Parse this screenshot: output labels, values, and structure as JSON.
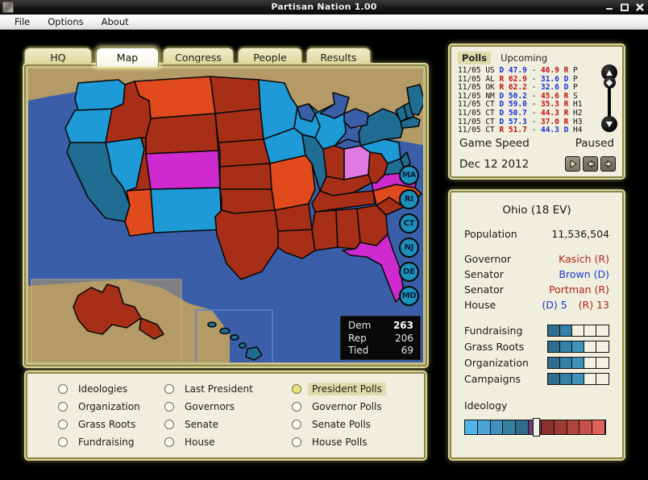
{
  "window": {
    "title": "Partisan Nation  1.00",
    "icon": "app-icon",
    "buttons": {
      "minimize": "minimize-icon",
      "maximize": "maximize-icon",
      "close": "close-icon"
    }
  },
  "menubar": {
    "items": [
      "File",
      "Options",
      "About"
    ]
  },
  "tabs": [
    {
      "label": "HQ",
      "active": false
    },
    {
      "label": "Map",
      "active": true
    },
    {
      "label": "Congress",
      "active": false
    },
    {
      "label": "People",
      "active": false
    },
    {
      "label": "Results",
      "active": false
    }
  ],
  "map": {
    "ev_box": {
      "rows": [
        {
          "label": "Dem",
          "value": "263"
        },
        {
          "label": "Rep",
          "value": "206"
        },
        {
          "label": "Tied",
          "value": "69"
        }
      ]
    },
    "state_circles": [
      "MA",
      "RI",
      "CT",
      "NJ",
      "DE",
      "MD"
    ],
    "ocean_color": "#3a5fa8",
    "land_color": "#b49a66",
    "colors": {
      "dem_strong": "#1f6d92",
      "dem": "#1e9ad6",
      "tied": "#cf2ad0",
      "tied_light": "#e07ae3",
      "rep": "#e04a1c",
      "rep_strong": "#a82f17"
    },
    "state_fills": {
      "WA": "dem",
      "OR": "dem",
      "CA": "dem_strong",
      "NV": "dem",
      "ID": "rep_strong",
      "MT": "rep",
      "WY": "rep_strong",
      "UT": "rep_strong",
      "CO": "tied",
      "AZ": "rep",
      "NM": "dem",
      "ND": "rep_strong",
      "SD": "rep_strong",
      "NE": "rep_strong",
      "KS": "rep_strong",
      "OK": "rep_strong",
      "TX": "rep_strong",
      "MN": "dem",
      "IA": "dem",
      "MO": "rep",
      "AR": "rep_strong",
      "LA": "rep_strong",
      "WI": "dem",
      "IL": "dem",
      "MI": "dem",
      "IN": "rep_strong",
      "OH": "tied_light",
      "KY": "rep_strong",
      "TN": "rep_strong",
      "MS": "rep_strong",
      "AL": "rep_strong",
      "GA": "rep_strong",
      "FL": "tied",
      "SC": "rep_strong",
      "NC": "rep",
      "VA": "tied",
      "WV": "rep_strong",
      "PA": "dem",
      "NY": "dem_strong",
      "ME": "dem_strong",
      "NH": "dem_strong",
      "VT": "dem_strong",
      "MA": "dem_strong",
      "AK": "rep_strong",
      "HI": "dem_strong"
    }
  },
  "options": {
    "columns": [
      [
        {
          "label": "Ideologies",
          "selected": false
        },
        {
          "label": "Organization",
          "selected": false
        },
        {
          "label": "Grass Roots",
          "selected": false
        },
        {
          "label": "Fundraising",
          "selected": false
        }
      ],
      [
        {
          "label": "Last President",
          "selected": false
        },
        {
          "label": "Governors",
          "selected": false
        },
        {
          "label": "Senate",
          "selected": false
        },
        {
          "label": "House",
          "selected": false
        }
      ],
      [
        {
          "label": "President Polls",
          "selected": true
        },
        {
          "label": "Governor Polls",
          "selected": false
        },
        {
          "label": "Senate Polls",
          "selected": false
        },
        {
          "label": "House Polls",
          "selected": false
        }
      ]
    ]
  },
  "polls": {
    "tabs": [
      {
        "label": "Polls",
        "active": true
      },
      {
        "label": "Upcoming",
        "active": false
      }
    ],
    "rows": [
      {
        "date": "11/05",
        "state": "US",
        "lead_party": "D",
        "lead_pct": "47.9",
        "trail_pct": "46.9",
        "trail_party": "R",
        "race": "P"
      },
      {
        "date": "11/05",
        "state": "AL",
        "lead_party": "R",
        "lead_pct": "62.9",
        "trail_pct": "31.6",
        "trail_party": "D",
        "race": "P"
      },
      {
        "date": "11/05",
        "state": "OK",
        "lead_party": "R",
        "lead_pct": "62.2",
        "trail_pct": "32.6",
        "trail_party": "D",
        "race": "P"
      },
      {
        "date": "11/05",
        "state": "NM",
        "lead_party": "D",
        "lead_pct": "50.2",
        "trail_pct": "45.6",
        "trail_party": "R",
        "race": "S"
      },
      {
        "date": "11/05",
        "state": "CT",
        "lead_party": "D",
        "lead_pct": "59.0",
        "trail_pct": "35.3",
        "trail_party": "R",
        "race": "H1"
      },
      {
        "date": "11/05",
        "state": "CT",
        "lead_party": "D",
        "lead_pct": "50.7",
        "trail_pct": "44.3",
        "trail_party": "R",
        "race": "H2"
      },
      {
        "date": "11/05",
        "state": "CT",
        "lead_party": "D",
        "lead_pct": "57.3",
        "trail_pct": "37.0",
        "trail_party": "R",
        "race": "H3"
      },
      {
        "date": "11/05",
        "state": "CT",
        "lead_party": "R",
        "lead_pct": "51.7",
        "trail_pct": "44.3",
        "trail_party": "D",
        "race": "H4"
      }
    ],
    "speed_label": "Game Speed",
    "speed_value": "Paused",
    "date": "Dec 12 2012",
    "buttons": [
      "play-icon",
      "speed-down-icon",
      "speed-up-icon"
    ],
    "scrollbar": {
      "up": "scroll-up-icon",
      "down": "scroll-down-icon",
      "thumb": "scroll-thumb"
    }
  },
  "state_info": {
    "title": "Ohio (18 EV)",
    "population_label": "Population",
    "population_value": "11,536,504",
    "rows": [
      {
        "label": "Governor",
        "value": "Kasich (R)",
        "party": "rep"
      },
      {
        "label": "Senator",
        "value": "Brown (D)",
        "party": "dem"
      },
      {
        "label": "Senator",
        "value": "Portman (R)",
        "party": "rep"
      }
    ],
    "house_label": "House",
    "house_dem": "(D) 5",
    "house_rep": "(R) 13",
    "meters": [
      {
        "label": "Fundraising",
        "filled": 2,
        "total": 5
      },
      {
        "label": "Grass Roots",
        "filled": 3,
        "total": 5
      },
      {
        "label": "Organization",
        "filled": 3,
        "total": 5
      },
      {
        "label": "Campaigns",
        "filled": 3,
        "total": 5
      }
    ],
    "ideology_label": "Ideology",
    "ideology_cells": [
      "#4fb4e6",
      "#4ba4d6",
      "#4090bd",
      "#357f ac",
      "#2e6b8e",
      "#6b3f7a",
      "#8b2f2f",
      "#9e3a34",
      "#b2433c",
      "#c45049",
      "#e0635a"
    ],
    "ideology_marker_index": 5
  }
}
